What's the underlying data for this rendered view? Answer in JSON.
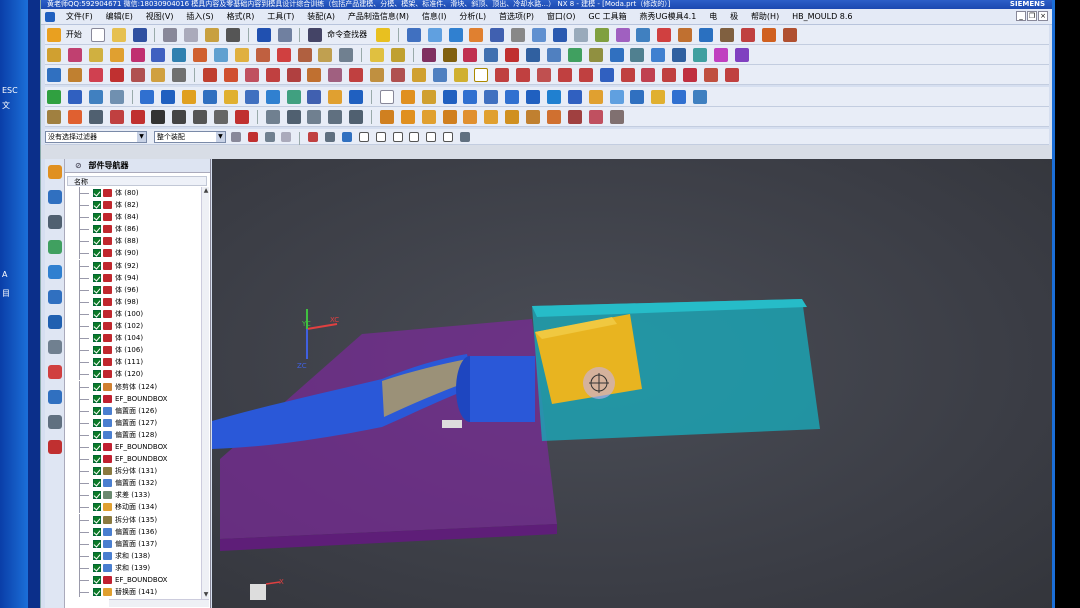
{
  "window": {
    "title": "黄老师QQ:592904671 微信:18030904016 模具内容及零基础内容到模具设计综合训练（包括产品建模、分模、模架、标准件、滑块、斜顶、顶出、冷却水路…）   NX 8 - 建模 - [Moda.prt（修改的）]",
    "brand": "SIEMENS"
  },
  "desktop_left_labels": [
    "ESC",
    "文",
    "A",
    "目"
  ],
  "menu": {
    "items": [
      "文件(F)",
      "编辑(E)",
      "视图(V)",
      "插入(S)",
      "格式(R)",
      "工具(T)",
      "装配(A)",
      "产品制造信息(M)",
      "信息(I)",
      "分析(L)",
      "首选项(P)",
      "窗口(O)",
      "GC 工具箱",
      "燕秀UG模具4.1",
      "电",
      "极",
      "帮助(H)",
      "HB_MOULD 8.6"
    ]
  },
  "toolbar": {
    "start_label": "开始",
    "command_finder_label": "命令查找器"
  },
  "filter": {
    "type_filter_value": "没有选择过滤器",
    "scope_value": "整个装配"
  },
  "part_navigator": {
    "title": "部件导航器",
    "column_name": "名称",
    "rows": [
      {
        "icon": "body",
        "label": "体 (80)"
      },
      {
        "icon": "body",
        "label": "体 (82)"
      },
      {
        "icon": "body",
        "label": "体 (84)"
      },
      {
        "icon": "body",
        "label": "体 (86)"
      },
      {
        "icon": "body",
        "label": "体 (88)"
      },
      {
        "icon": "body",
        "label": "体 (90)"
      },
      {
        "icon": "body",
        "label": "体 (92)"
      },
      {
        "icon": "body",
        "label": "体 (94)"
      },
      {
        "icon": "body",
        "label": "体 (96)"
      },
      {
        "icon": "body",
        "label": "体 (98)"
      },
      {
        "icon": "body",
        "label": "体 (100)"
      },
      {
        "icon": "body",
        "label": "体 (102)"
      },
      {
        "icon": "body",
        "label": "体 (104)"
      },
      {
        "icon": "body",
        "label": "体 (106)"
      },
      {
        "icon": "body",
        "label": "体 (111)"
      },
      {
        "icon": "body",
        "label": "体 (120)"
      },
      {
        "icon": "trim",
        "label": "修剪体 (124)"
      },
      {
        "icon": "bbox",
        "label": "EF_BOUNDBOX"
      },
      {
        "icon": "offset",
        "label": "偏置面 (126)"
      },
      {
        "icon": "offset",
        "label": "偏置面 (127)"
      },
      {
        "icon": "offset",
        "label": "偏置面 (128)"
      },
      {
        "icon": "bbox",
        "label": "EF_BOUNDBOX"
      },
      {
        "icon": "bbox",
        "label": "EF_BOUNDBOX"
      },
      {
        "icon": "split",
        "label": "拆分体 (131)"
      },
      {
        "icon": "offset",
        "label": "偏置面 (132)"
      },
      {
        "icon": "subtract",
        "label": "求差 (133)"
      },
      {
        "icon": "move",
        "label": "移动面 (134)"
      },
      {
        "icon": "split",
        "label": "拆分体 (135)"
      },
      {
        "icon": "offset",
        "label": "偏置面 (136)"
      },
      {
        "icon": "offset",
        "label": "偏置面 (137)"
      },
      {
        "icon": "unite",
        "label": "求和 (138)"
      },
      {
        "icon": "unite",
        "label": "求和 (139)"
      },
      {
        "icon": "bbox",
        "label": "EF_BOUNDBOX"
      },
      {
        "icon": "replace",
        "label": "替换面 (141)"
      }
    ]
  },
  "triad": {
    "xc": "XC",
    "yc": "YC",
    "zc": "ZC",
    "x": "X"
  },
  "colors": {
    "body_icon": "#c0282e",
    "offset_icon": "#4a7fd0",
    "check_green": "#0c7a26",
    "viewport_bg": "#3c3e46",
    "purple_block": "#7b2a9a",
    "cyan_block": "#1aa8b8",
    "yellow_block": "#e8b420",
    "blue_part": "#2a58d8"
  }
}
